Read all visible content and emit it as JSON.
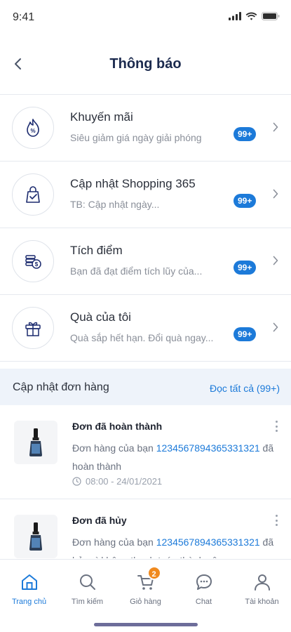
{
  "status_bar": {
    "time": "9:41"
  },
  "header": {
    "title": "Thông báo"
  },
  "categories": [
    {
      "title": "Khuyến mãi",
      "subtitle": "Siêu giảm giá ngày giải phóng",
      "badge": "99+",
      "icon": "promo-icon"
    },
    {
      "title": "Cập nhật Shopping 365",
      "subtitle": "TB: Cập nhật ngày...",
      "badge": "99+",
      "icon": "shopping-bag-icon"
    },
    {
      "title": "Tích điểm",
      "subtitle": "Bạn đã đạt điểm tích lũy của...",
      "badge": "99+",
      "icon": "coins-icon"
    },
    {
      "title": "Quà của tôi",
      "subtitle": "Quà sắp hết hạn. Đổi quà ngay...",
      "badge": "99+",
      "icon": "gift-icon"
    }
  ],
  "order_section": {
    "title": "Cập nhật đơn hàng",
    "read_all": "Đọc tất cả (99+)"
  },
  "orders": [
    {
      "title": "Đơn đã hoàn thành",
      "prefix": "Đơn hàng của bạn ",
      "order_id": "1234567894365331321",
      "suffix": " đã hoàn thành",
      "time": "08:00 - 24/01/2021"
    },
    {
      "title": "Đơn đã hủy",
      "prefix": "Đơn hàng của bạn ",
      "order_id": "1234567894365331321",
      "suffix": " đã hủy vì không thanh toán thành công",
      "time": ""
    }
  ],
  "tabbar": {
    "items": [
      {
        "label": "Trang chủ",
        "icon": "home-icon",
        "active": true
      },
      {
        "label": "Tìm kiếm",
        "icon": "search-icon",
        "active": false
      },
      {
        "label": "Giỏ hàng",
        "icon": "cart-icon",
        "active": false,
        "badge": "2"
      },
      {
        "label": "Chat",
        "icon": "chat-icon",
        "active": false
      },
      {
        "label": "Tài khoản",
        "icon": "user-icon",
        "active": false
      }
    ]
  },
  "colors": {
    "accent": "#1c7ad9",
    "title": "#1b2a4e",
    "badge_orange": "#f08a1f",
    "section_bg": "#eef3fa"
  }
}
